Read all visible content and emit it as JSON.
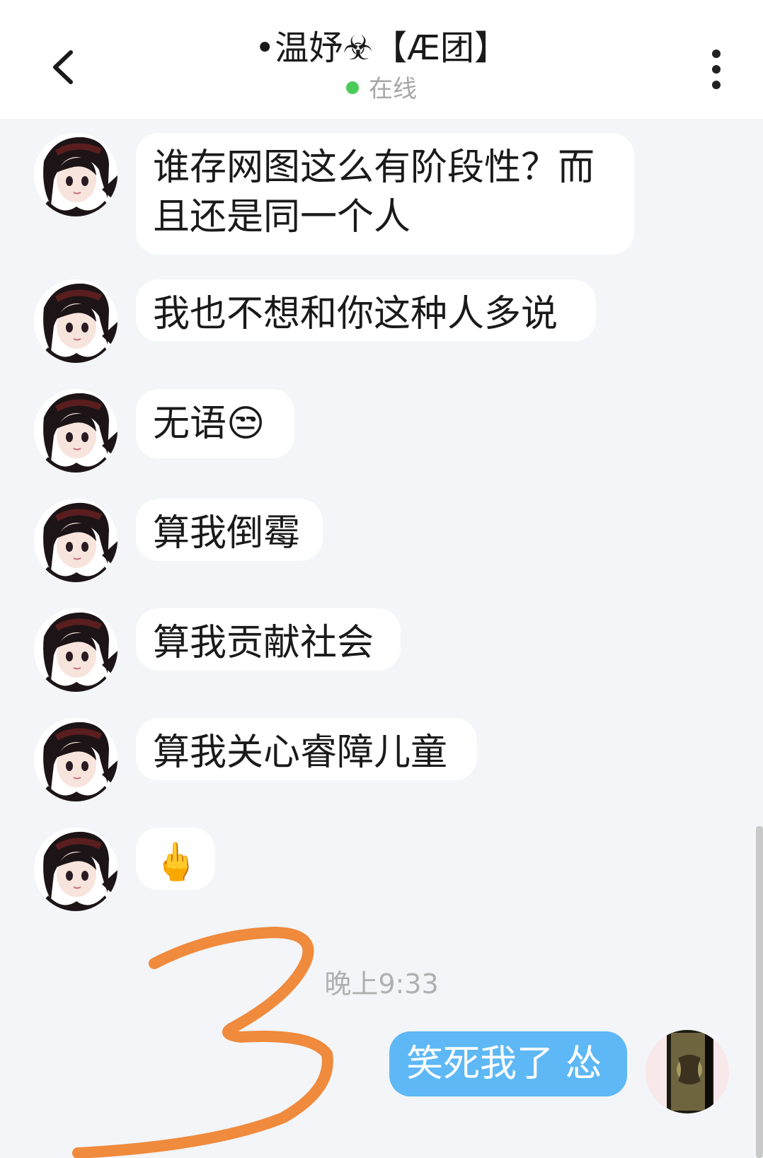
{
  "header": {
    "title": "•温妤☣【Æ团】",
    "status_text": "在线",
    "status_color": "#4ccb5d",
    "back_icon": "chevron-left-icon",
    "more_icon": "more-vertical-icon"
  },
  "messages": [
    {
      "sender": "other",
      "text": "谁存网图这么有阶段性？而且还是同一个人"
    },
    {
      "sender": "other",
      "text": "我也不想和你这种人多说"
    },
    {
      "sender": "other",
      "text": "无语",
      "emoji": "😒"
    },
    {
      "sender": "other",
      "text": "算我倒霉"
    },
    {
      "sender": "other",
      "text": "算我贡献社会"
    },
    {
      "sender": "other",
      "text": "算我关心睿障儿童"
    },
    {
      "sender": "other",
      "text": "",
      "emoji": "🖕"
    }
  ],
  "timestamp": "晚上9:33",
  "my_message": {
    "text": "笑死我了 怂"
  },
  "overlay": {
    "annotation_color": "#f08a3c"
  }
}
